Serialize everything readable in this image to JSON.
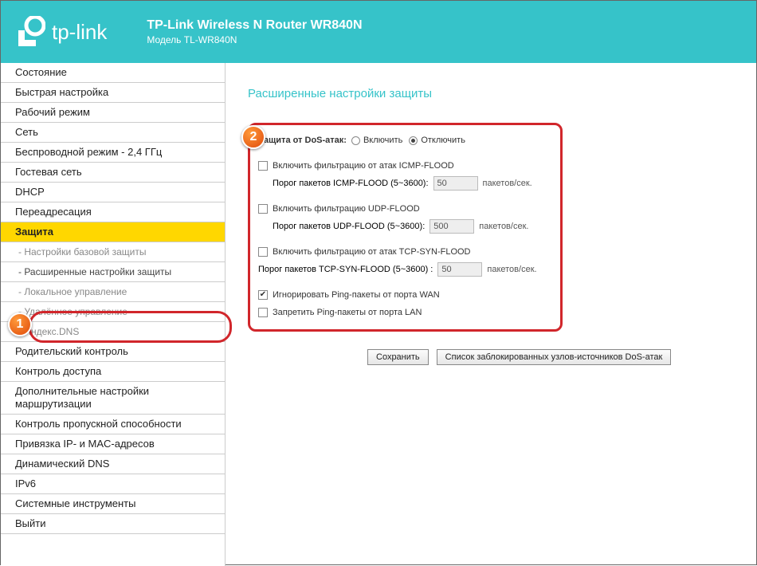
{
  "header": {
    "brand": "tp-link",
    "title": "TP-Link Wireless N Router WR840N",
    "subtitle": "Модель TL-WR840N"
  },
  "sidebar": {
    "items": [
      "Состояние",
      "Быстрая настройка",
      "Рабочий режим",
      "Сеть",
      "Беспроводной режим - 2,4 ГГц",
      "Гостевая сеть",
      "DHCP",
      "Переадресация"
    ],
    "active": "Защита",
    "subs": [
      "- Настройки базовой защиты",
      "- Расширенные настройки защиты",
      "- Локальное управление",
      "- Удалённое управление",
      "- Яндекс.DNS"
    ],
    "items2": [
      "Родительский контроль",
      "Контроль доступа",
      "Дополнительные настройки маршрутизации",
      "Контроль пропускной способности",
      "Привязка IP- и MAC-адресов",
      "Динамический DNS",
      "IPv6",
      "Системные инструменты",
      "Выйти"
    ]
  },
  "content": {
    "title": "Расширенные настройки защиты",
    "dos": {
      "label": "Защита от DoS-атак:",
      "enable": "Включить",
      "disable": "Отключить"
    },
    "icmp": {
      "chk": "Включить фильтрацию от атак ICMP-FLOOD",
      "threshold": "Порог пакетов ICMP-FLOOD (5~3600):",
      "value": "50",
      "unit": "пакетов/сек."
    },
    "udp": {
      "chk": "Включить фильтрацию UDP-FLOOD",
      "threshold": "Порог пакетов UDP-FLOOD (5~3600):",
      "value": "500",
      "unit": "пакетов/сек."
    },
    "tcp": {
      "chk": "Включить фильтрацию от атак TCP-SYN-FLOOD",
      "threshold": "Порог пакетов TCP-SYN-FLOOD (5~3600) :",
      "value": "50",
      "unit": "пакетов/сек."
    },
    "ping_wan": "Игнорировать Ping-пакеты от порта WAN",
    "ping_lan": "Запретить Ping-пакеты от порта LAN",
    "buttons": {
      "save": "Сохранить",
      "list": "Список заблокированных узлов-источников DoS-атак"
    }
  },
  "badges": {
    "b1": "1",
    "b2": "2"
  }
}
